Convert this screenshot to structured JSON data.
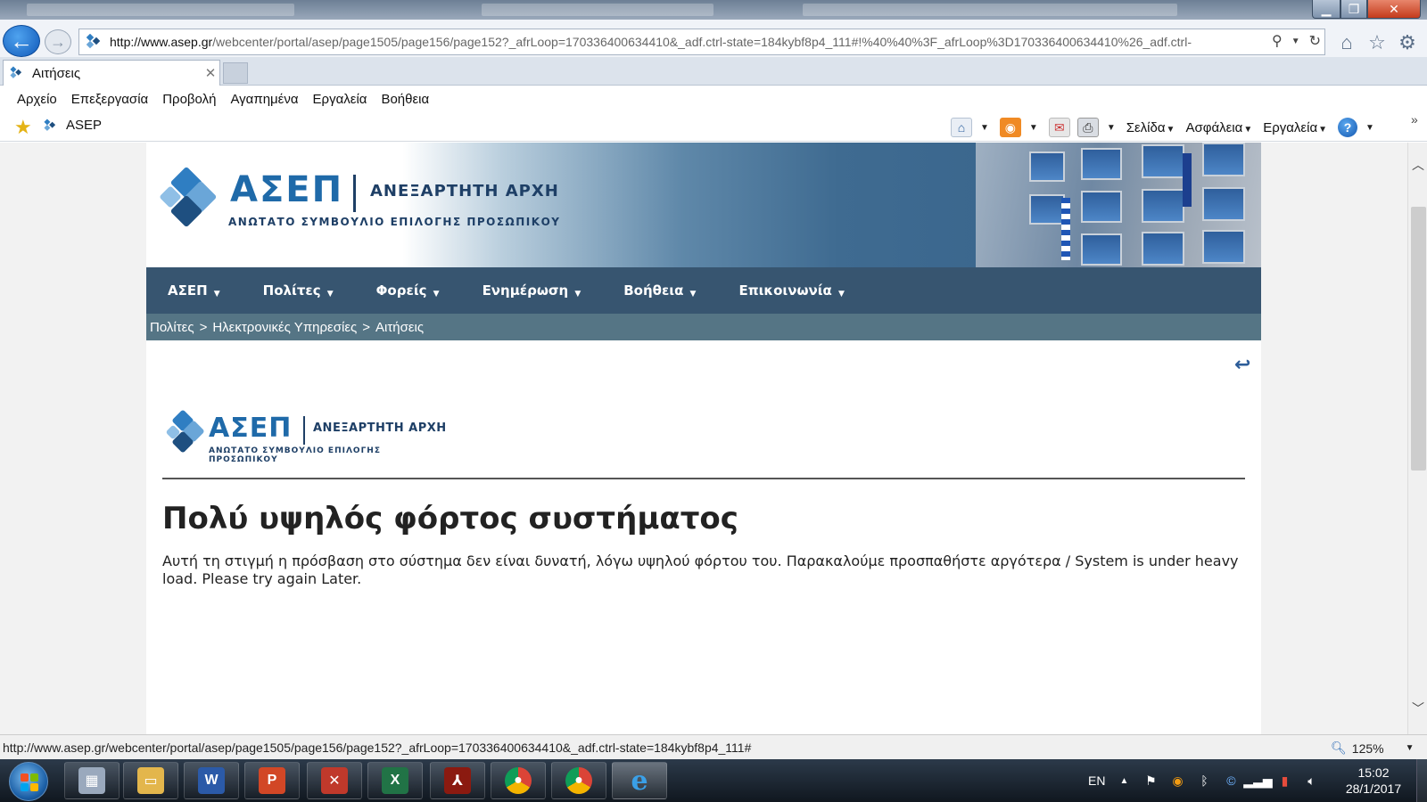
{
  "browser": {
    "url_host": "http://www.asep.gr",
    "url_rest": "/webcenter/portal/asep/page1505/page156/page152?_afrLoop=170336400634410&_adf.ctrl-state=184kybf8p4_111#!%40%40%3F_afrLoop%3D170336400634410%26_adf.ctrl-",
    "tab_title": "Αιτήσεις",
    "menu": [
      "Αρχείο",
      "Επεξεργασία",
      "Προβολή",
      "Αγαπημένα",
      "Εργαλεία",
      "Βοήθεια"
    ],
    "favorite_link": "ASEP",
    "command_bar": {
      "page": "Σελίδα",
      "safety": "Ασφάλεια",
      "tools": "Εργαλεία"
    },
    "status_url": "http://www.asep.gr/webcenter/portal/asep/page1505/page156/page152?_afrLoop=170336400634410&_adf.ctrl-state=184kybf8p4_111#",
    "zoom": "125%"
  },
  "site": {
    "logo_name": "ΑΣΕΠ",
    "logo_authority": "ΑΝΕΞΑΡΤΗΤΗ ΑΡΧΗ",
    "logo_subtitle": "ΑΝΩΤΑΤΟ ΣΥΜΒΟΥΛΙΟ ΕΠΙΛΟΓΗΣ ΠΡΟΣΩΠΙΚΟΥ",
    "nav": [
      "ΑΣΕΠ",
      "Πολίτες",
      "Φορείς",
      "Ενημέρωση",
      "Βοήθεια",
      "Επικοινωνία"
    ],
    "breadcrumb": [
      "Πολίτες",
      "Ηλεκτρονικές Υπηρεσίες",
      "Αιτήσεις"
    ],
    "breadcrumb_sep": ">",
    "error_title": "Πολύ υψηλός φόρτος συστήματος",
    "error_message": "Αυτή τη στιγμή η πρόσβαση στο σύστημα δεν είναι δυνατή, λόγω υψηλού φόρτου του. Παρακαλούμε προσπαθήστε αργότερα / System is under heavy load. Please try again Later."
  },
  "taskbar": {
    "language": "EN",
    "time": "15:02",
    "date": "28/1/2017"
  },
  "colors": {
    "nav_bg": "#375570",
    "breadcrumb_bg": "#557585",
    "logo_blue": "#1f6aa9"
  },
  "icons": {
    "back": "arrow-left",
    "forward": "arrow-right",
    "search": "magnifier",
    "refresh": "refresh",
    "home": "house",
    "favorites": "star",
    "settings": "gear"
  }
}
